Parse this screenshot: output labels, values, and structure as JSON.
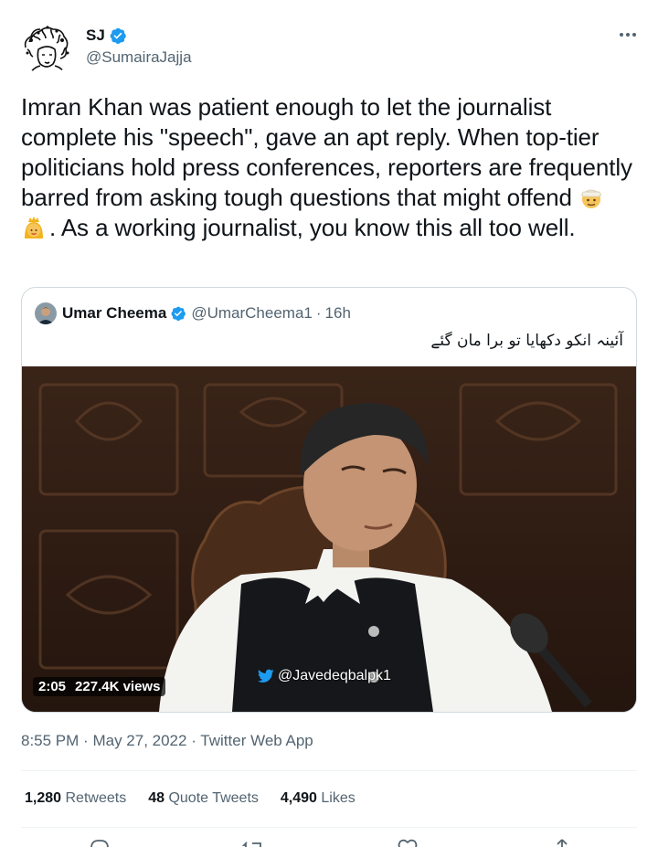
{
  "author": {
    "display_name": "SJ",
    "handle": "@SumairaJajja"
  },
  "tweet": {
    "text_part1": "Imran Khan was patient enough to let the journalist complete his \"speech\", gave an apt reply. When top-tier politicians hold press conferences, reporters are frequently barred from asking tough questions that might offend ",
    "text_part2": ". As a working journalist, you know this all too well.",
    "emojis": [
      "man-with-turban-emoji",
      "woman-with-crown-emoji"
    ]
  },
  "quote": {
    "display_name": "Umar Cheema",
    "handle": "@UmarCheema1",
    "separator": "·",
    "time": "16h",
    "text": "آئینہ انکو دکھایا تو برا مان گئے",
    "video": {
      "duration": "2:05",
      "views": "227.4K views",
      "watermark": "@Javedeqbalpk1"
    }
  },
  "meta": {
    "time": "8:55 PM",
    "sep1": "·",
    "date": "May 27, 2022",
    "sep2": "·",
    "source": "Twitter Web App"
  },
  "stats": {
    "retweets_count": "1,280",
    "retweets_label": "Retweets",
    "quotes_count": "48",
    "quotes_label": "Quote Tweets",
    "likes_count": "4,490",
    "likes_label": "Likes"
  },
  "colors": {
    "text": "#0f1419",
    "secondary": "#536471",
    "verified": "#1d9bf0",
    "border": "#cfd9de"
  }
}
